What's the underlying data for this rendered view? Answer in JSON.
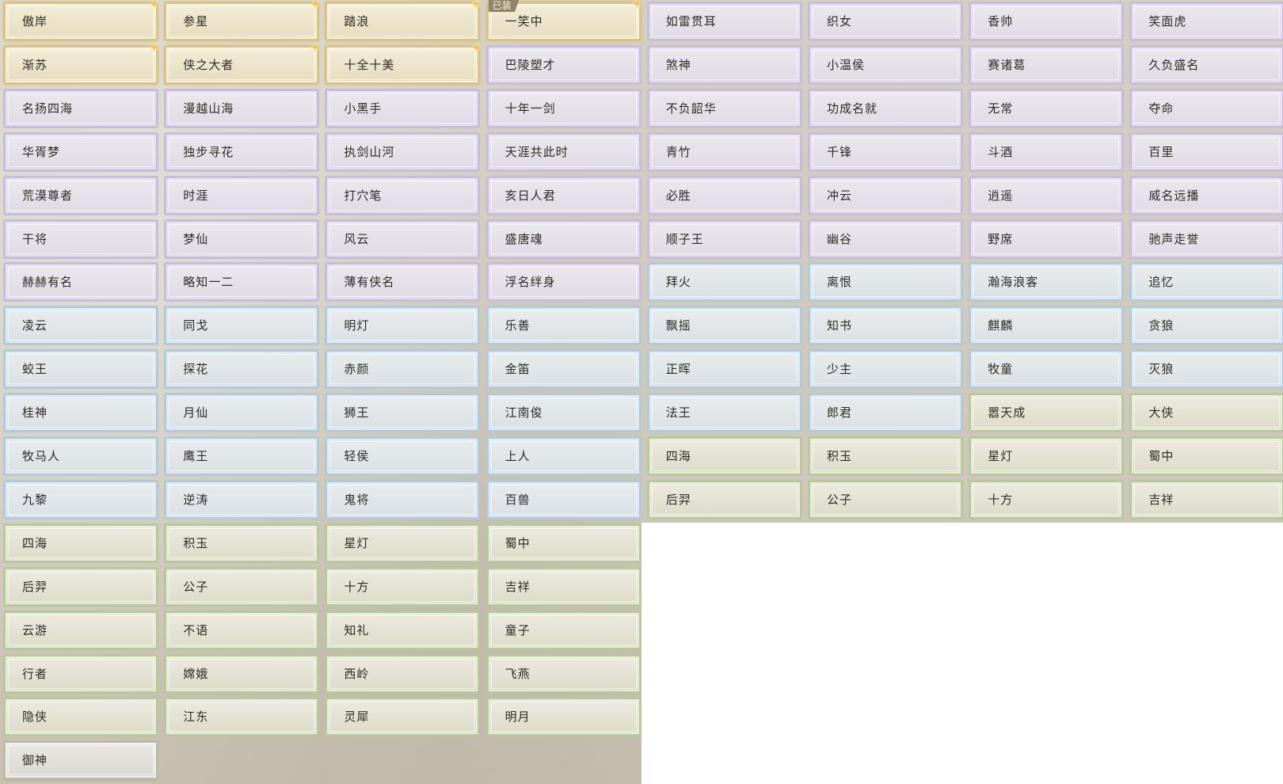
{
  "equipped_badge": "已装",
  "titles": [
    {
      "label": "傲岸",
      "tier": "gold"
    },
    {
      "label": "参星",
      "tier": "gold"
    },
    {
      "label": "踏浪",
      "tier": "gold"
    },
    {
      "label": "一笑中",
      "tier": "gold",
      "equipped": true
    },
    {
      "label": "如雷贯耳",
      "tier": "purple"
    },
    {
      "label": "织女",
      "tier": "purple"
    },
    {
      "label": "香帅",
      "tier": "purple"
    },
    {
      "label": "笑面虎",
      "tier": "purple"
    },
    {
      "label": "渐苏",
      "tier": "gold"
    },
    {
      "label": "侠之大者",
      "tier": "gold"
    },
    {
      "label": "十全十美",
      "tier": "gold"
    },
    {
      "label": "巴陵塑才",
      "tier": "purple"
    },
    {
      "label": "煞神",
      "tier": "purple"
    },
    {
      "label": "小温侯",
      "tier": "purple"
    },
    {
      "label": "赛诸葛",
      "tier": "purple"
    },
    {
      "label": "久负盛名",
      "tier": "purple"
    },
    {
      "label": "名扬四海",
      "tier": "purple"
    },
    {
      "label": "漫越山海",
      "tier": "purple"
    },
    {
      "label": "小黑手",
      "tier": "purple"
    },
    {
      "label": "十年一剑",
      "tier": "purple"
    },
    {
      "label": "不负韶华",
      "tier": "purple"
    },
    {
      "label": "功成名就",
      "tier": "purple"
    },
    {
      "label": "无常",
      "tier": "purple"
    },
    {
      "label": "夺命",
      "tier": "purple"
    },
    {
      "label": "华胥梦",
      "tier": "purple"
    },
    {
      "label": "独步寻花",
      "tier": "purple"
    },
    {
      "label": "执剑山河",
      "tier": "purple"
    },
    {
      "label": "天涯共此时",
      "tier": "purple"
    },
    {
      "label": "青竹",
      "tier": "purple"
    },
    {
      "label": "千锋",
      "tier": "purple"
    },
    {
      "label": "斗酒",
      "tier": "purple"
    },
    {
      "label": "百里",
      "tier": "purple"
    },
    {
      "label": "荒漠尊者",
      "tier": "purple"
    },
    {
      "label": "时涯",
      "tier": "purple"
    },
    {
      "label": "打穴笔",
      "tier": "purple"
    },
    {
      "label": "亥日人君",
      "tier": "purple"
    },
    {
      "label": "必胜",
      "tier": "purple"
    },
    {
      "label": "冲云",
      "tier": "purple"
    },
    {
      "label": "逍遥",
      "tier": "purple"
    },
    {
      "label": "威名远播",
      "tier": "purple"
    },
    {
      "label": "干将",
      "tier": "purple"
    },
    {
      "label": "梦仙",
      "tier": "purple"
    },
    {
      "label": "风云",
      "tier": "purple"
    },
    {
      "label": "盛唐魂",
      "tier": "purple"
    },
    {
      "label": "顺子王",
      "tier": "purple"
    },
    {
      "label": "幽谷",
      "tier": "purple"
    },
    {
      "label": "野席",
      "tier": "purple"
    },
    {
      "label": "驰声走誉",
      "tier": "purple"
    },
    {
      "label": "赫赫有名",
      "tier": "purple"
    },
    {
      "label": "略知一二",
      "tier": "purple"
    },
    {
      "label": "薄有侠名",
      "tier": "purple"
    },
    {
      "label": "浮名绊身",
      "tier": "purple"
    },
    {
      "label": "拜火",
      "tier": "blue"
    },
    {
      "label": "离恨",
      "tier": "blue"
    },
    {
      "label": "瀚海浪客",
      "tier": "blue"
    },
    {
      "label": "追忆",
      "tier": "blue"
    },
    {
      "label": "凌云",
      "tier": "blue"
    },
    {
      "label": "同戈",
      "tier": "blue"
    },
    {
      "label": "明灯",
      "tier": "blue"
    },
    {
      "label": "乐善",
      "tier": "blue"
    },
    {
      "label": "飘摇",
      "tier": "blue"
    },
    {
      "label": "知书",
      "tier": "blue"
    },
    {
      "label": "麒麟",
      "tier": "blue"
    },
    {
      "label": "贪狼",
      "tier": "blue"
    },
    {
      "label": "蛟王",
      "tier": "blue"
    },
    {
      "label": "探花",
      "tier": "blue"
    },
    {
      "label": "赤颜",
      "tier": "blue"
    },
    {
      "label": "金笛",
      "tier": "blue"
    },
    {
      "label": "正晖",
      "tier": "blue"
    },
    {
      "label": "少主",
      "tier": "blue"
    },
    {
      "label": "牧童",
      "tier": "blue"
    },
    {
      "label": "灭狼",
      "tier": "blue"
    },
    {
      "label": "桂神",
      "tier": "blue"
    },
    {
      "label": "月仙",
      "tier": "blue"
    },
    {
      "label": "狮王",
      "tier": "blue"
    },
    {
      "label": "江南俊",
      "tier": "blue"
    },
    {
      "label": "法王",
      "tier": "blue"
    },
    {
      "label": "郎君",
      "tier": "blue"
    },
    {
      "label": "嚣天成",
      "tier": "green"
    },
    {
      "label": "大侠",
      "tier": "green"
    },
    {
      "label": "牧马人",
      "tier": "blue"
    },
    {
      "label": "鹰王",
      "tier": "blue"
    },
    {
      "label": "轻侯",
      "tier": "blue"
    },
    {
      "label": "上人",
      "tier": "blue"
    },
    {
      "label": "四海",
      "tier": "green"
    },
    {
      "label": "积玉",
      "tier": "green"
    },
    {
      "label": "星灯",
      "tier": "green"
    },
    {
      "label": "蜀中",
      "tier": "green"
    },
    {
      "label": "九黎",
      "tier": "blue"
    },
    {
      "label": "逆涛",
      "tier": "blue"
    },
    {
      "label": "鬼将",
      "tier": "blue"
    },
    {
      "label": "百兽",
      "tier": "blue"
    },
    {
      "label": "后羿",
      "tier": "green"
    },
    {
      "label": "公子",
      "tier": "green"
    },
    {
      "label": "十方",
      "tier": "green"
    },
    {
      "label": "吉祥",
      "tier": "green"
    },
    {
      "label": "四海",
      "tier": "green"
    },
    {
      "label": "积玉",
      "tier": "green"
    },
    {
      "label": "星灯",
      "tier": "green"
    },
    {
      "label": "蜀中",
      "tier": "green"
    },
    {
      "label": "后羿",
      "tier": "green"
    },
    {
      "label": "公子",
      "tier": "green"
    },
    {
      "label": "十方",
      "tier": "green"
    },
    {
      "label": "吉祥",
      "tier": "green"
    },
    {
      "label": "云游",
      "tier": "green"
    },
    {
      "label": "不语",
      "tier": "green"
    },
    {
      "label": "知礼",
      "tier": "green"
    },
    {
      "label": "童子",
      "tier": "green"
    },
    {
      "label": "行者",
      "tier": "green"
    },
    {
      "label": "嫦娥",
      "tier": "green"
    },
    {
      "label": "西岭",
      "tier": "green"
    },
    {
      "label": "飞燕",
      "tier": "green"
    },
    {
      "label": "隐侠",
      "tier": "green"
    },
    {
      "label": "江东",
      "tier": "green"
    },
    {
      "label": "灵犀",
      "tier": "green"
    },
    {
      "label": "明月",
      "tier": "green"
    },
    {
      "label": "御神",
      "tier": "plain"
    }
  ]
}
